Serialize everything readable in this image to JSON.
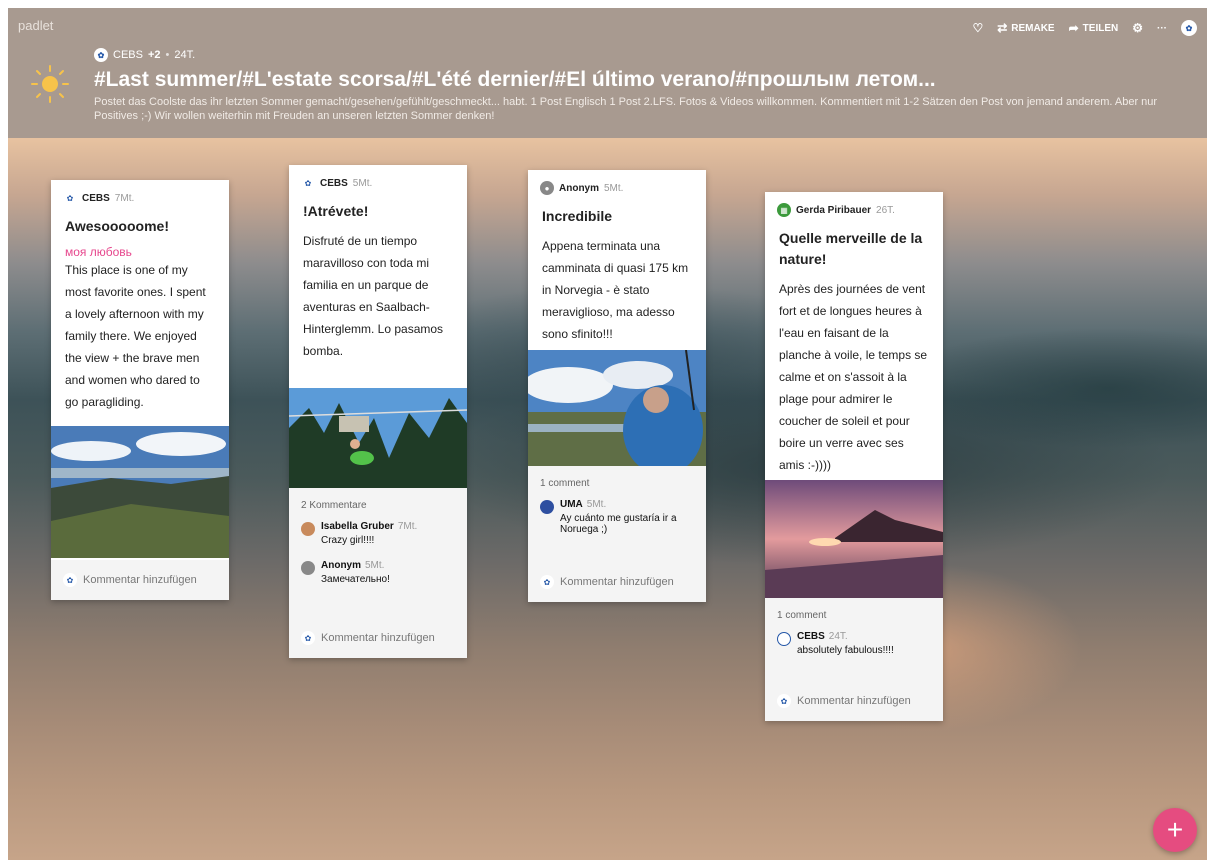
{
  "app": {
    "brand": "padlet"
  },
  "header": {
    "author": "CEBS",
    "contributors": "+2",
    "age": "24T.",
    "title": "#Last summer/#L'estate scorsa/#L'été dernier/#El último verano/#прошлым летом...",
    "description": "Postet das Coolste das ihr letzten Sommer gemacht/gesehen/gefühlt/geschmeckt... habt. 1 Post Englisch 1 Post 2.LFS. Fotos & Videos willkommen. Kommentiert mit 1-2 Sätzen den Post von jemand anderem. Aber nur Positives ;-) Wir wollen weiterhin mit Freuden an unseren letzten Sommer denken!",
    "sun_icon": "sun-icon"
  },
  "toolbar": {
    "like_icon": "heart-icon",
    "remake": "REMAKE",
    "share": "TEILEN",
    "settings_icon": "gear-icon",
    "more": "···"
  },
  "posts": [
    {
      "author": "CEBS",
      "age": "7Mt.",
      "title": "Awesooooome!",
      "subtitle": "моя любовь",
      "body": "This place is one of my most favorite ones. I spent a lovely afternoon with my family there. We enjoyed the view + the brave men and women who dared to go paragliding.",
      "image_icon": "mountain-landscape-photo",
      "comment_count": "",
      "comments": [],
      "add_comment": "Kommentar hinzufügen"
    },
    {
      "author": "CEBS",
      "age": "5Mt.",
      "title": "!Atrévete!",
      "body": "Disfruté de un tiempo maravilloso con toda mi familia en un parque de aventuras en Saalbach-Hinterglemm. Lo pasamos bomba.",
      "image_icon": "zipline-photo",
      "comment_count": "2 Kommentare",
      "comments": [
        {
          "author": "Isabella Gruber",
          "age": "7Mt.",
          "text": "Crazy girl!!!!"
        },
        {
          "author": "Anonym",
          "age": "5Mt.",
          "text": "Замечательно!"
        }
      ],
      "add_comment": "Kommentar hinzufügen"
    },
    {
      "author": "Anonym",
      "age": "5Mt.",
      "title": "Incredibile",
      "body": "Appena terminata una camminata di quasi 175 km in Norvegia - è stato meraviglioso, ma adesso sono sfinito!!!",
      "image_icon": "norway-hiker-photo",
      "comment_count": "1 comment",
      "comments": [
        {
          "author": "UMA",
          "age": "5Mt.",
          "text": "Ay cuánto me gustaría ir a Noruega ;)"
        }
      ],
      "add_comment": "Kommentar hinzufügen"
    },
    {
      "author": "Gerda Piribauer",
      "age": "26T.",
      "title": "Quelle merveille de la nature!",
      "body": "Après des journées de vent fort et de longues heures à l'eau en faisant de la planche à voile, le temps se calme et on s'assoit à la plage pour admirer le coucher de soleil et pour boire un verre avec ses amis :-))))",
      "image_icon": "sunset-beach-photo",
      "comment_count": "1 comment",
      "comments": [
        {
          "author": "CEBS",
          "age": "24T.",
          "text": "absolutely fabulous!!!!"
        }
      ],
      "add_comment": "Kommentar hinzufügen"
    }
  ],
  "fab": {
    "label": "+"
  },
  "colors": {
    "header": "#a89a90",
    "accent": "#e54c80",
    "subtitle": "#e6478d"
  }
}
